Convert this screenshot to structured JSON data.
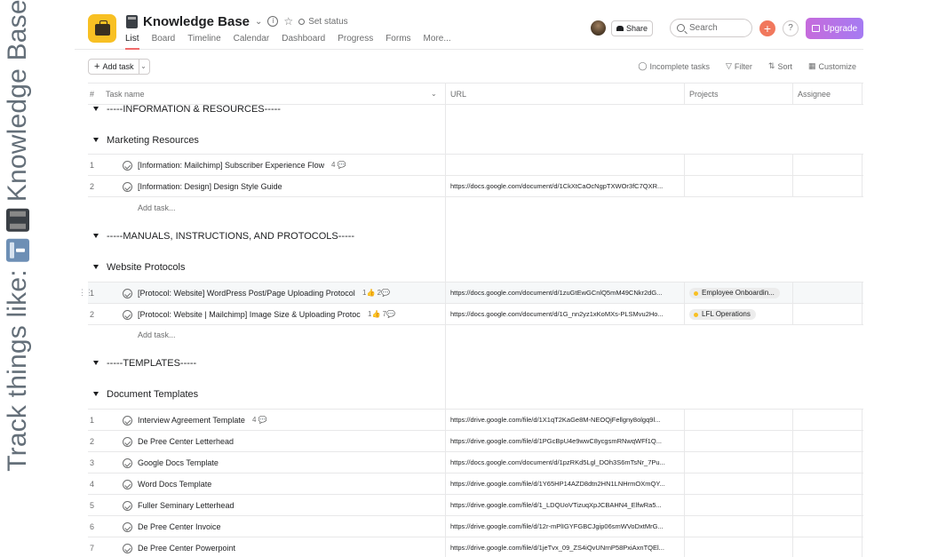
{
  "side_caption": {
    "prefix": "Track things like:",
    "suffix": "Knowledge Base"
  },
  "header": {
    "title": "Knowledge Base",
    "set_status": "Set status",
    "tabs": [
      "List",
      "Board",
      "Timeline",
      "Calendar",
      "Dashboard",
      "Progress",
      "Forms",
      "More..."
    ],
    "share": "Share",
    "search_placeholder": "Search",
    "upgrade": "Upgrade",
    "help": "?"
  },
  "toolbar": {
    "add_task": "Add task",
    "incomplete": "Incomplete tasks",
    "filter": "Filter",
    "sort": "Sort",
    "customize": "Customize"
  },
  "columns": {
    "num": "#",
    "task_name": "Task name",
    "url": "URL",
    "projects": "Projects",
    "assignee": "Assignee"
  },
  "sections": {
    "s1": "-----INFORMATION & RESOURCES-----",
    "s2": "Marketing Resources",
    "s3": "-----MANUALS, INSTRUCTIONS, AND PROTOCOLS-----",
    "s4": "Website Protocols",
    "s5": "-----TEMPLATES-----",
    "s6": "Document Templates"
  },
  "add_task_inline": "Add task...",
  "marketing_rows": [
    {
      "num": "1",
      "name": "[Information: Mailchimp] Subscriber Experience Flow",
      "meta": "4 💬",
      "url": ""
    },
    {
      "num": "2",
      "name": "[Information: Design] Design Style Guide",
      "meta": "",
      "url": "https://docs.google.com/document/d/1CkXtCaOcNgpTXWOr3fC7QXR..."
    }
  ],
  "protocol_rows": [
    {
      "num": "1",
      "name": "[Protocol: Website] WordPress Post/Page Uploading Protocol",
      "meta": "1👍  2💬",
      "url": "https://docs.google.com/document/d/1zuGtEwGCnlQ5mM49CNkr2dG...",
      "project": "Employee Onboardin..."
    },
    {
      "num": "2",
      "name": "[Protocol: Website | Mailchimp] Image Size & Uploading Protoc",
      "meta": "1👍  7💬",
      "url": "https://docs.google.com/document/d/1G_nn2yz1xKoMXs-PLSMvu2Ho...",
      "project": "LFL Operations"
    }
  ],
  "template_rows": [
    {
      "num": "1",
      "name": "Interview Agreement Template",
      "meta": "4 💬",
      "url": "https://drive.google.com/file/d/1X1qT2KaGe8M-NEOQjFellgny8olgq9l..."
    },
    {
      "num": "2",
      "name": "De Pree Center Letterhead",
      "meta": "",
      "url": "https://drive.google.com/file/d/1PGcBpU4e9wwC8ycgsmRNwqWFf1Q..."
    },
    {
      "num": "3",
      "name": "Google Docs Template",
      "meta": "",
      "url": "https://docs.google.com/document/d/1pzRKd5Lgl_DOh3S6mTsNr_7Pu..."
    },
    {
      "num": "4",
      "name": "Word Docs Template",
      "meta": "",
      "url": "https://drive.google.com/file/d/1Y65HP14AZD8dtn2HN1LNHrmOXmQY..."
    },
    {
      "num": "5",
      "name": "Fuller Seminary Letterhead",
      "meta": "",
      "url": "https://drive.google.com/file/d/1_LDQUoVTizuqXpJCBAHN4_ElfwRa5..."
    },
    {
      "num": "6",
      "name": "De Pree Center Invoice",
      "meta": "",
      "url": "https://drive.google.com/file/d/12r-mPlIGYFGBCJgip06smWVoDxtMrG..."
    },
    {
      "num": "7",
      "name": "De Pree Center Powerpoint",
      "meta": "",
      "url": "https://drive.google.com/file/d/1jeTvx_09_ZS4iQvUNrnP58PxiAxnTQEl..."
    }
  ]
}
